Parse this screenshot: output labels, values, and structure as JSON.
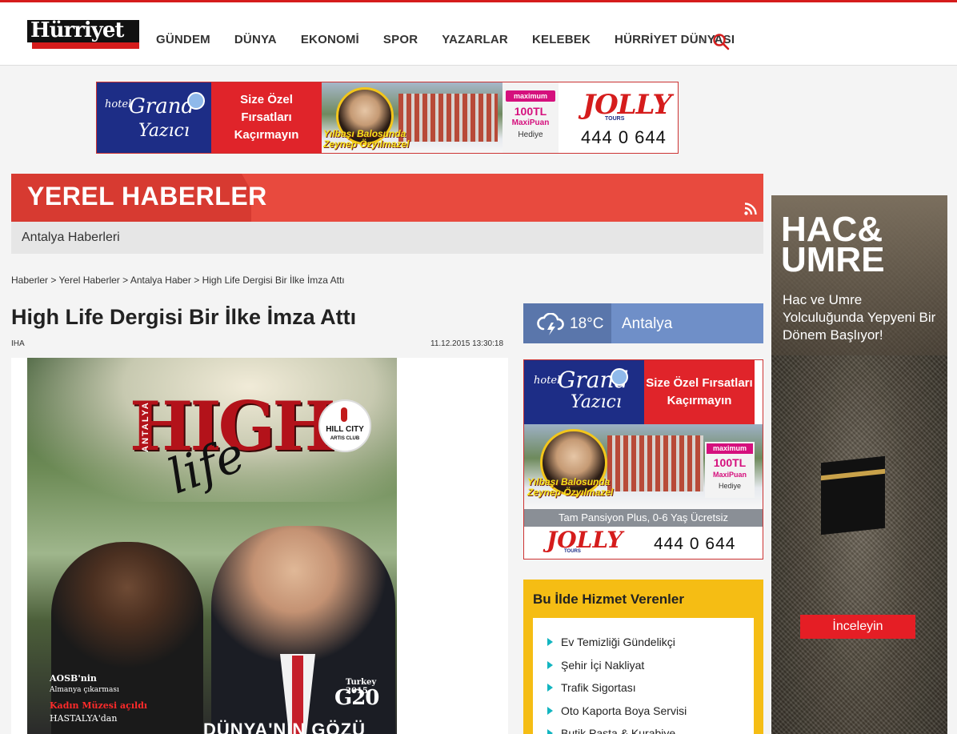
{
  "header": {
    "logo_text": "Hürriyet",
    "nav": [
      "GÜNDEM",
      "DÜNYA",
      "EKONOMİ",
      "SPOR",
      "YAZARLAR",
      "KELEBEK",
      "HÜRRİYET DÜNYASI"
    ],
    "more_glyph": "⌄"
  },
  "banner": {
    "hotel_small": "hotel",
    "hotel_big": "Grand",
    "hotel_name": "Yazıcı",
    "offer_line1": "Size Özel Fırsatları",
    "offer_line2": "Kaçırmayın",
    "photo_cap1": "Yılbaşı Balosunda",
    "photo_cap2": "Zeynep Özyılmazel",
    "maximum": "maximum",
    "puan_amount": "100TL",
    "puan": "MaxiPuan",
    "hediye": "Hediye",
    "jolly": "JOLLY",
    "tours": "TOURS",
    "phone": "444 0 644"
  },
  "section": {
    "title": "YEREL HABERLER",
    "subtitle": "Antalya Haberleri"
  },
  "breadcrumb": [
    "Haberler",
    "Yerel Haberler",
    "Antalya Haber",
    "High Life Dergisi Bir İlke İmza Attı"
  ],
  "breadcrumb_sep": ">",
  "article": {
    "title": "High Life Dergisi Bir İlke İmza Attı",
    "source": "IHA",
    "date": "11.12.2015 13:30:18",
    "cover": {
      "high": "HIGH",
      "antalya": "ANTALYA",
      "life": "life",
      "hill_city": "HILL CITY",
      "artis_club": "ARTIS CLUB",
      "cap1": "AOSB'nin",
      "cap2": "Almanya çıkarması",
      "cap3": "Kadın Müzesi açıldı",
      "cap4": "HASTALYA'dan",
      "turkey": "Turkey 2015",
      "g20": "G20",
      "bottom": "DÜNYA'NIN GÖZÜ"
    }
  },
  "weather": {
    "temp": "18°C",
    "city": "Antalya"
  },
  "side_ad": {
    "hotel_small": "hotel",
    "hotel_big": "Grand",
    "hotel_name": "Yazıcı",
    "offer_line1": "Size Özel Fırsatları",
    "offer_line2": "Kaçırmayın",
    "photo_cap1": "Yılbaşı Balosunda",
    "photo_cap2": "Zeynep Özyılmazel",
    "maximum": "maximum",
    "puan_amount": "100TL",
    "puan": "MaxiPuan",
    "hediye": "Hediye",
    "strip": "Tam Pansiyon Plus, 0-6 Yaş Ücretsiz",
    "jolly": "JOLLY",
    "tours": "TOURS",
    "phone": "444 0 644"
  },
  "services": {
    "title": "Bu İlde Hizmet Verenler",
    "items": [
      "Ev Temizliği Gündelikçi",
      "Şehir İçi Nakliyat",
      "Trafik Sigortası",
      "Oto Kaporta Boya Servisi",
      "Butik Pasta & Kurabiye"
    ]
  },
  "right_ad": {
    "headline1": "HAC&",
    "headline2": "UMRE",
    "text": "Hac ve Umre Yolculuğunda Yepyeni Bir Dönem Başlıyor!",
    "button": "İnceleyin"
  },
  "colors": {
    "brand_red": "#d51c1c",
    "section_red": "#e84a3e",
    "weather_blue": "#6f8fc8",
    "services_yellow": "#f5bd14",
    "bullet_teal": "#12b5c0"
  }
}
